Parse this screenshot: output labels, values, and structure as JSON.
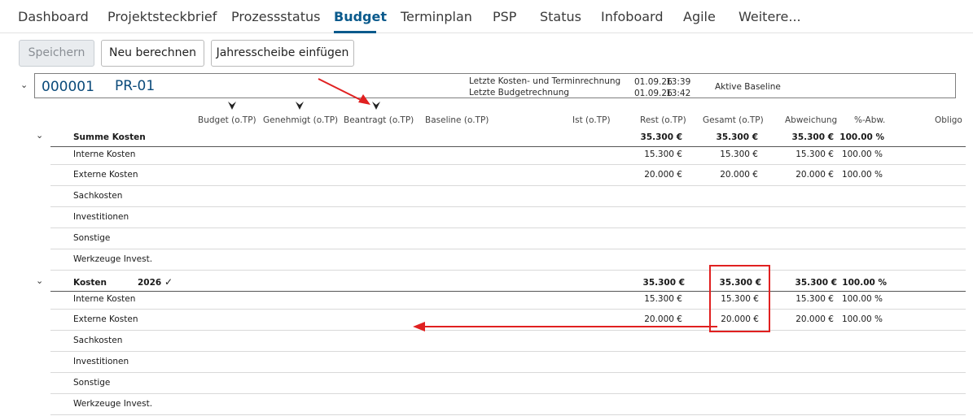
{
  "tabs": [
    {
      "label": "Dashboard"
    },
    {
      "label": "Projektsteckbrief"
    },
    {
      "label": "Prozessstatus"
    },
    {
      "label": "Budget"
    },
    {
      "label": "Terminplan"
    },
    {
      "label": "PSP"
    },
    {
      "label": "Status"
    },
    {
      "label": "Infoboard"
    },
    {
      "label": "Agile"
    },
    {
      "label": "Weitere..."
    }
  ],
  "active_tab": "Budget",
  "toolbar": {
    "save_label": "Speichern",
    "recalc_label": "Neu berechnen",
    "insert_year_label": "Jahresscheibe einfügen"
  },
  "project": {
    "number": "000001",
    "name": "PR-01",
    "last_cost_label": "Letzte Kosten- und Terminrechnung",
    "last_cost_date": "01.09.26",
    "last_cost_time": "13:39",
    "last_budget_label": "Letzte Budgetrechnung",
    "last_budget_date": "01.09.26",
    "last_budget_time": "13:42",
    "baseline_label": "Aktive Baseline"
  },
  "columns": {
    "budget": "Budget (o.TP)",
    "genehmigt": "Genehmigt (o.TP)",
    "beantragt": "Beantragt (o.TP)",
    "baseline": "Baseline (o.TP)",
    "ist": "Ist (o.TP)",
    "rest": "Rest (o.TP)",
    "gesamt": "Gesamt (o.TP)",
    "abweichung": "Abweichung",
    "abw_pct": "%-Abw.",
    "obligo": "Obligo"
  },
  "summe": {
    "label": "Summe Kosten",
    "rest": "35.300 €",
    "gesamt": "35.300 €",
    "abweichung": "35.300 €",
    "abw_pct": "100.00 %",
    "rows": [
      {
        "label": "Interne Kosten",
        "rest": "15.300 €",
        "gesamt": "15.300 €",
        "abweichung": "15.300 €",
        "abw_pct": "100.00 %"
      },
      {
        "label": "Externe Kosten",
        "rest": "20.000 €",
        "gesamt": "20.000 €",
        "abweichung": "20.000 €",
        "abw_pct": "100.00 %"
      },
      {
        "label": "Sachkosten"
      },
      {
        "label": "Investitionen"
      },
      {
        "label": "Sonstige"
      },
      {
        "label": "Werkzeuge Invest."
      }
    ]
  },
  "kosten": {
    "label": "Kosten",
    "year": "2026",
    "rest": "35.300 €",
    "gesamt": "35.300 €",
    "abweichung": "35.300 €",
    "abw_pct": "100.00 %",
    "rows": [
      {
        "label": "Interne Kosten",
        "rest": "15.300 €",
        "gesamt": "15.300 €",
        "abweichung": "15.300 €",
        "abw_pct": "100.00 %"
      },
      {
        "label": "Externe Kosten",
        "rest": "20.000 €",
        "gesamt": "20.000 €",
        "abweichung": "20.000 €",
        "abw_pct": "100.00 %"
      },
      {
        "label": "Sachkosten"
      },
      {
        "label": "Investitionen"
      },
      {
        "label": "Sonstige"
      },
      {
        "label": "Werkzeuge Invest."
      }
    ]
  },
  "colors": {
    "accent": "#0a5a8c",
    "annotation": "#e02020"
  }
}
